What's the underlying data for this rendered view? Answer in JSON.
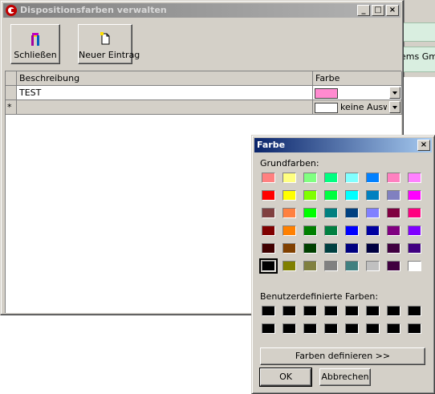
{
  "background": {
    "cut_text": "ems Gm"
  },
  "window": {
    "title": "Dispositionsfarben verwalten",
    "controls": {
      "minimize": "_",
      "maximize": "□",
      "close": "×"
    }
  },
  "toolbar": {
    "close_label": "Schließen",
    "new_label": "Neuer Eintrag"
  },
  "grid": {
    "columns": {
      "description": "Beschreibung",
      "color": "Farbe"
    },
    "rows": [
      {
        "marker": "",
        "description": "TEST",
        "color_text": "",
        "color": "#ff8ad0"
      },
      {
        "marker": "*",
        "description": "",
        "color_text": "keine Auswahl",
        "color": "#ffffff"
      }
    ]
  },
  "color_dialog": {
    "title": "Farbe",
    "basic_label": "Grundfarben:",
    "custom_label": "Benutzerdefinierte Farben:",
    "define_button": "Farben definieren >>",
    "ok_button": "OK",
    "cancel_button": "Abbrechen",
    "basic_colors": [
      [
        "#ff8080",
        "#ffff80",
        "#80ff80",
        "#00ff80",
        "#80ffff",
        "#0080ff",
        "#ff80c0",
        "#ff80ff"
      ],
      [
        "#ff0000",
        "#ffff00",
        "#80ff00",
        "#00ff40",
        "#00ffff",
        "#0080c0",
        "#8080c0",
        "#ff00ff"
      ],
      [
        "#804040",
        "#ff8040",
        "#00ff00",
        "#008080",
        "#004080",
        "#8080ff",
        "#800040",
        "#ff0080"
      ],
      [
        "#800000",
        "#ff8000",
        "#008000",
        "#008040",
        "#0000ff",
        "#0000a0",
        "#800080",
        "#8000ff"
      ],
      [
        "#400000",
        "#804000",
        "#004000",
        "#004040",
        "#000080",
        "#000040",
        "#400040",
        "#400080"
      ],
      [
        "#000000",
        "#808000",
        "#808040",
        "#808080",
        "#408080",
        "#c0c0c0",
        "#400040",
        "#ffffff"
      ]
    ],
    "selected_basic": [
      5,
      0
    ],
    "custom_colors": [
      [
        "#000000",
        "#000000",
        "#000000",
        "#000000",
        "#000000",
        "#000000",
        "#000000",
        "#000000"
      ],
      [
        "#000000",
        "#000000",
        "#000000",
        "#000000",
        "#000000",
        "#000000",
        "#000000",
        "#000000"
      ]
    ]
  }
}
